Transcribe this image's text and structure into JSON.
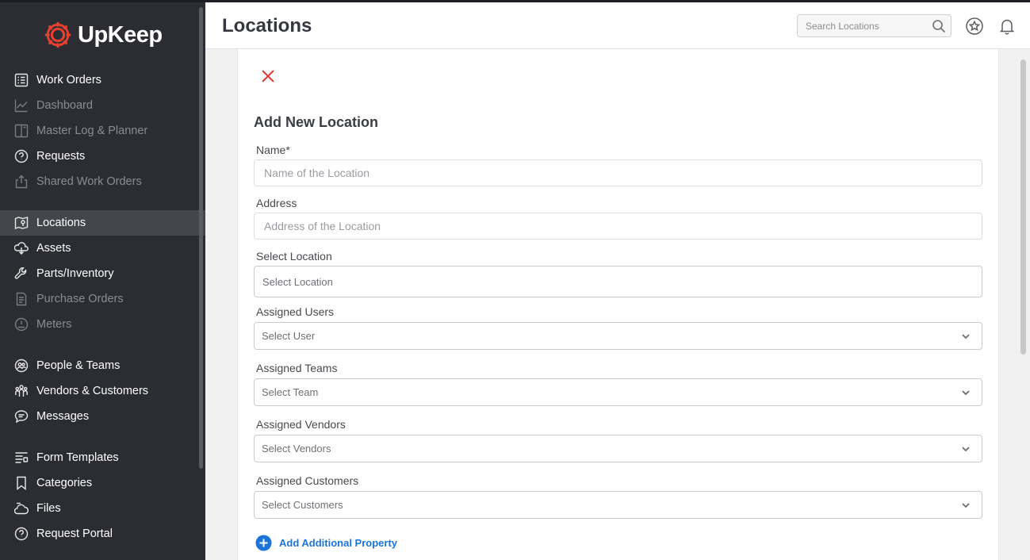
{
  "app": {
    "brand": "UpKeep",
    "accent_color": "#e8412f",
    "link_color": "#1b74d9"
  },
  "sidebar": {
    "items": [
      {
        "label": "Work Orders",
        "icon": "list-icon",
        "state": "normal"
      },
      {
        "label": "Dashboard",
        "icon": "chart-icon",
        "state": "disabled"
      },
      {
        "label": "Master Log & Planner",
        "icon": "book-icon",
        "state": "disabled"
      },
      {
        "label": "Requests",
        "icon": "question-circle-icon",
        "state": "normal"
      },
      {
        "label": "Shared Work Orders",
        "icon": "share-icon",
        "state": "disabled"
      },
      {
        "label": "Locations",
        "icon": "map-pin-icon",
        "state": "active"
      },
      {
        "label": "Assets",
        "icon": "cube-icon",
        "state": "normal"
      },
      {
        "label": "Parts/Inventory",
        "icon": "wrench-icon",
        "state": "normal"
      },
      {
        "label": "Purchase Orders",
        "icon": "document-icon",
        "state": "disabled"
      },
      {
        "label": "Meters",
        "icon": "gauge-icon",
        "state": "disabled"
      },
      {
        "label": "People & Teams",
        "icon": "people-icon",
        "state": "normal"
      },
      {
        "label": "Vendors & Customers",
        "icon": "group-icon",
        "state": "normal"
      },
      {
        "label": "Messages",
        "icon": "chat-icon",
        "state": "normal"
      },
      {
        "label": "Form Templates",
        "icon": "form-icon",
        "state": "normal"
      },
      {
        "label": "Categories",
        "icon": "bookmark-icon",
        "state": "normal"
      },
      {
        "label": "Files",
        "icon": "cloud-file-icon",
        "state": "normal"
      },
      {
        "label": "Request Portal",
        "icon": "question-circle-icon",
        "state": "normal"
      }
    ]
  },
  "header": {
    "title": "Locations",
    "search_placeholder": "Search Locations"
  },
  "form": {
    "title": "Add New Location",
    "name_label": "Name*",
    "name_placeholder": "Name of the Location",
    "address_label": "Address",
    "address_placeholder": "Address of the Location",
    "parent_label": "Select Location",
    "parent_placeholder": "Select Location",
    "users_label": "Assigned Users",
    "users_placeholder": "Select User",
    "teams_label": "Assigned Teams",
    "teams_placeholder": "Select Team",
    "vendors_label": "Assigned Vendors",
    "vendors_placeholder": "Select Vendors",
    "customers_label": "Assigned Customers",
    "customers_placeholder": "Select Customers",
    "add_property_label": "Add Additional Property"
  }
}
